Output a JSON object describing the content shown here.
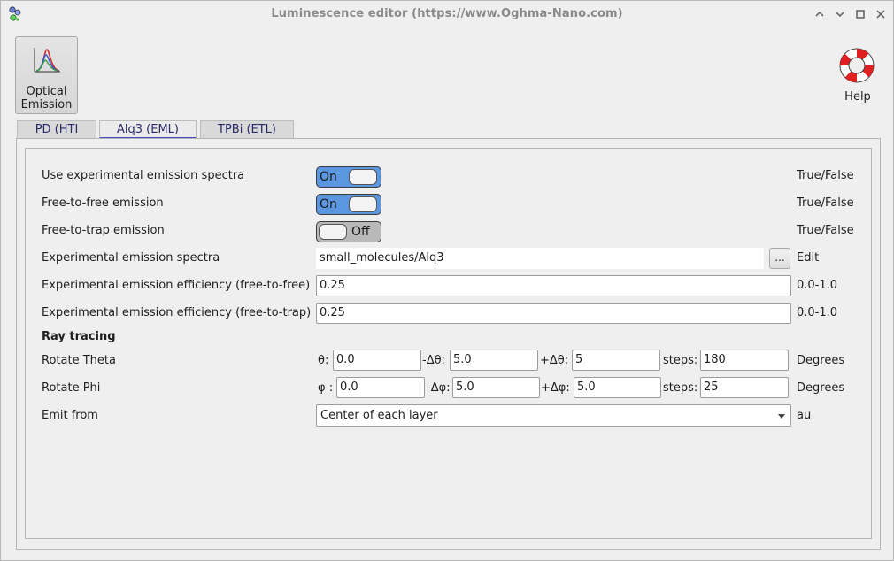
{
  "window": {
    "title": "Luminescence editor (https://www.Oghma-Nano.com)",
    "controls": [
      "minimize-icon",
      "maximize-icon",
      "restore-icon",
      "close-icon"
    ]
  },
  "ribbon": {
    "optical_emission_label": "Optical\nEmission",
    "help_label": "Help"
  },
  "tabs": [
    {
      "label": "PD (HTI"
    },
    {
      "label": "Alq3 (EML)",
      "active": true
    },
    {
      "label": "TPBi (ETL)"
    }
  ],
  "rows": {
    "use_exp_spectra": {
      "label": "Use experimental emission spectra",
      "state": "On",
      "unit": "True/False"
    },
    "free_to_free": {
      "label": "Free-to-free emission",
      "state": "On",
      "unit": "True/False"
    },
    "free_to_trap": {
      "label": "Free-to-trap emission",
      "state": "Off",
      "unit": "True/False"
    },
    "exp_spectra": {
      "label": "Experimental emission spectra",
      "value": "small_molecules/Alq3",
      "button": "...",
      "unit": "Edit"
    },
    "eff_ff": {
      "label": "Experimental emission efficiency (free-to-free)",
      "value": "0.25",
      "unit": "0.0-1.0"
    },
    "eff_ft": {
      "label": "Experimental emission efficiency (free-to-trap)",
      "value": "0.25",
      "unit": "0.0-1.0"
    },
    "ray_tracing": {
      "label": "Ray tracing"
    },
    "rotate_theta": {
      "label": "Rotate Theta",
      "start_label": "θ:",
      "start": "0.0",
      "minus_label": "-Δθ:",
      "minus": "5.0",
      "plus_label": "+Δθ:",
      "plus": "5",
      "steps_label": "steps:",
      "steps": "180",
      "unit": "Degrees"
    },
    "rotate_phi": {
      "label": "Rotate Phi",
      "start_label": "φ :",
      "start": "0.0",
      "minus_label": "-Δφ:",
      "minus": "5.0",
      "plus_label": "+Δφ:",
      "plus": "5.0",
      "steps_label": "steps:",
      "steps": "25",
      "unit": "Degrees"
    },
    "emit_from": {
      "label": "Emit from",
      "value": "Center of each layer",
      "unit": "au"
    }
  },
  "colors": {
    "toggle_on": "#5b96e0",
    "toggle_off": "#b9b9b9",
    "tab_accent": "#4a4ac0"
  }
}
